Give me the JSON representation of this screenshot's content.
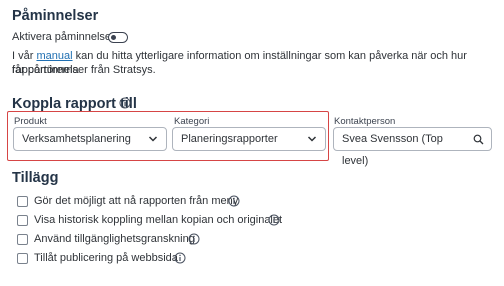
{
  "reminders": {
    "title": "Påminnelser",
    "activate_label": "Aktivera påminnelser",
    "toggle_on": false,
    "info_text_prefix": "I vår",
    "manual_link": "manual",
    "info_text_suffix_line1": "kan du hitta ytterligare information om inställningar som kan påverka när och hur rapportörerna",
    "info_text_line2": "får påminnelser från Stratsys."
  },
  "link_report": {
    "title": "Koppla rapport till",
    "fields": {
      "product": {
        "label": "Produkt",
        "value": "Verksamhetsplanering"
      },
      "category": {
        "label": "Kategori",
        "value": "Planeringsrapporter"
      },
      "contact": {
        "label": "Kontaktperson",
        "value": "Svea Svensson (Top level)"
      }
    }
  },
  "addons": {
    "title": "Tillägg",
    "options": [
      {
        "label": "Gör det möjligt att nå rapporten från meny",
        "checked": false
      },
      {
        "label": "Visa historisk koppling mellan kopian och originalet",
        "checked": false
      },
      {
        "label": "Använd tillgänglighetsgranskning",
        "checked": false
      },
      {
        "label": "Tillåt publicering på webbsida",
        "checked": false
      }
    ]
  },
  "colors": {
    "highlight": "#d64545",
    "link": "#1f6fb2",
    "heading": "#243447"
  }
}
